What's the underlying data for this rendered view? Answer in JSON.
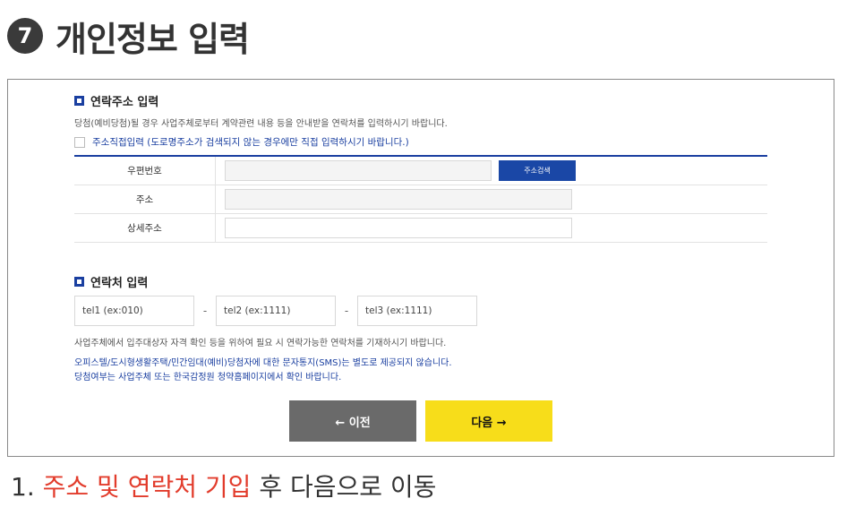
{
  "heading": {
    "step": "7",
    "title": "개인정보 입력"
  },
  "address_section": {
    "title": "연락주소 입력",
    "description": "당첨(예비당첨)될 경우 사업주체로부터 계약관련 내용 등을 안내받을 연락처를 입력하시기 바랍니다.",
    "direct_input_label": "주소직접입력 (도로명주소가 검색되지 않는 경우에만 직접 입력하시기 바랍니다.)",
    "rows": [
      {
        "label": "우편번호"
      },
      {
        "label": "주소"
      },
      {
        "label": "상세주소"
      }
    ],
    "search_button": "주소검색"
  },
  "contact_section": {
    "title": "연락처 입력",
    "tel1_placeholder": "tel1 (ex:010)",
    "tel2_placeholder": "tel2 (ex:1111)",
    "tel3_placeholder": "tel3 (ex:1111)",
    "separator": "-",
    "note": "사업주체에서 입주대상자 자격 확인 등을 위하여 필요 시 연락가능한 연락처를 기재하시기 바랍니다.",
    "notice_line1": "오피스텔/도시형생활주택/민간임대(예비)당첨자에 대한 문자통지(SMS)는 별도로 제공되지 않습니다.",
    "notice_line2": "당첨여부는 사업주체 또는 한국감정원 청약홈페이지에서 확인 바랍니다."
  },
  "buttons": {
    "prev": "← 이전",
    "next": "다음 →"
  },
  "caption": {
    "prefix": "1. ",
    "highlight": "주소 및 연락처 기입",
    "suffix": " 후 다음으로 이동"
  },
  "colors": {
    "accent_blue": "#1a3fa0",
    "next_yellow": "#f7dd1a",
    "prev_gray": "#6a6a6a",
    "caption_red": "#e23c2c"
  }
}
